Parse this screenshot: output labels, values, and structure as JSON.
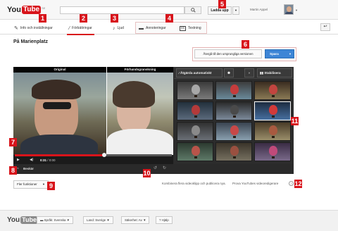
{
  "header": {
    "logo_you": "You",
    "logo_tube": "Tube",
    "logo_suffix": "SE",
    "upload_label": "Ladda upp",
    "username": "Martin Appel",
    "avatar": "user-avatar"
  },
  "tabs": [
    {
      "label": "Info och inställningar",
      "icon": "pencil-icon"
    },
    {
      "label": "Förbättringar",
      "icon": "magic-wand-icon"
    },
    {
      "label": "Ljud",
      "icon": "music-note-icon"
    },
    {
      "label": "Annoteringar",
      "icon": "speech-bubble-icon"
    },
    {
      "label": "Textning",
      "icon": "cc-icon"
    }
  ],
  "page": {
    "title": "På Marienplatz",
    "revert_label": "Återgå till den ursprungliga versionen",
    "save_label": "Spara"
  },
  "video": {
    "original_label": "Original",
    "preview_label": "Förhandsgranskning",
    "time_current": "0:31",
    "time_total": "0:00",
    "progress": 0.57
  },
  "strip": {
    "trim_label": "Beskär"
  },
  "panel": {
    "auto_fix_label": "Åtgärda automatiskt",
    "stabilize_label": "Stabilisera",
    "filter_count": 12,
    "selected_filter": 5
  },
  "below": {
    "more_label": "Fler funktioner",
    "combine_text": "Kombinera flera videoklipp och publicera nya.",
    "try_text": "Prova YouTubes videoredigerare",
    "help_glyph": "?"
  },
  "footer": {
    "language_label": "Språk: Svenska",
    "country_label": "Land: Sverige",
    "safety_label": "Säkerhet: Av",
    "help_label": "Hjälp"
  },
  "callouts": [
    "1",
    "2",
    "3",
    "4",
    "5",
    "6",
    "7",
    "8",
    "9",
    "10",
    "11",
    "12"
  ],
  "colors": {
    "accent_red": "#d8141b",
    "save_blue": "#3d85d6",
    "editor_dark": "#2a2a2a"
  }
}
